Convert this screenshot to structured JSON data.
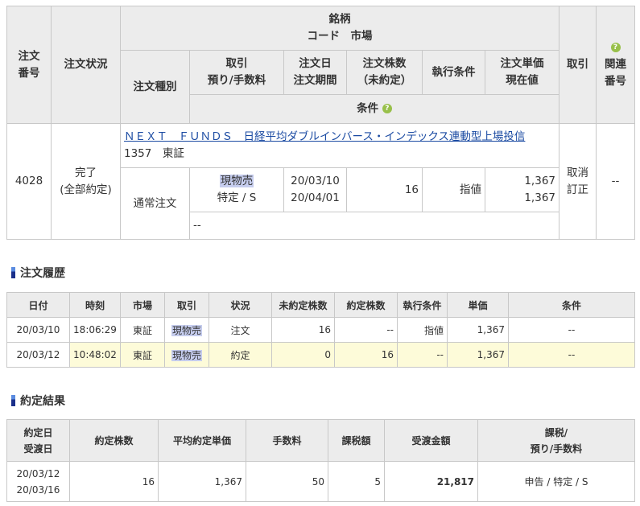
{
  "order_table": {
    "headers": {
      "order_no": [
        "注文",
        "番号"
      ],
      "order_status": "注文状況",
      "issue": [
        "銘柄",
        "コード　市場"
      ],
      "order_type": "注文種別",
      "trade": [
        "取引",
        "預り/手数料"
      ],
      "order_date": [
        "注文日",
        "注文期間"
      ],
      "shares": [
        "注文株数",
        "（未約定）"
      ],
      "exec_cond": "執行条件",
      "price": [
        "注文単価",
        "現在値"
      ],
      "action": "取引",
      "related": [
        "関連",
        "番号"
      ],
      "condition": "条件",
      "help_glyph": "?"
    },
    "row": {
      "order_no": "4028",
      "status": [
        "完了",
        "(全部約定)"
      ],
      "issue_name": "ＮＥＸＴ　ＦＵＮＤＳ　日経平均ダブルインバース・インデックス連動型上場投信",
      "issue_code_market": "1357　東証",
      "order_type": "通常注文",
      "trade": "現物売",
      "account": "特定 / S",
      "order_date": "20/03/10",
      "period": "20/04/01",
      "shares": "16",
      "exec_cond": "指値",
      "price": "1,367",
      "current": "1,367",
      "action_cancel": "取消",
      "action_modify": "訂正",
      "related": "--",
      "condition": "--"
    }
  },
  "history": {
    "title": "注文履歴",
    "columns": [
      "日付",
      "時刻",
      "市場",
      "取引",
      "状況",
      "未約定株数",
      "約定株数",
      "執行条件",
      "単価",
      "条件"
    ],
    "rows": [
      [
        "20/03/10",
        "18:06:29",
        "東証",
        "現物売",
        "注文",
        "16",
        "--",
        "指値",
        "1,367",
        "--"
      ],
      [
        "20/03/12",
        "10:48:02",
        "東証",
        "現物売",
        "約定",
        "0",
        "16",
        "--",
        "1,367",
        "--"
      ]
    ]
  },
  "execution": {
    "title": "約定結果",
    "columns": {
      "date": [
        "約定日",
        "受渡日"
      ],
      "shares": "約定株数",
      "avg_price": "平均約定単価",
      "fee": "手数料",
      "tax": "課税額",
      "amount": "受渡金額",
      "tax_type": [
        "課税/",
        "預り/手数料"
      ]
    },
    "row": {
      "exec_date": "20/03/12",
      "settle_date": "20/03/16",
      "shares": "16",
      "avg_price": "1,367",
      "fee": "50",
      "tax": "5",
      "amount": "21,817",
      "tax_type": "申告 / 特定 / S"
    }
  },
  "colors": {
    "header_bg": "#ececec",
    "highlight_row": "#fdfbd9",
    "trade_highlight": "#c6cdee",
    "link": "#1a4aa2",
    "help_icon": "#98c04a",
    "section_bar": "#1a2f8a"
  },
  "icons": {
    "help": "help-question-icon",
    "section_marker": "section-bar-icon"
  }
}
